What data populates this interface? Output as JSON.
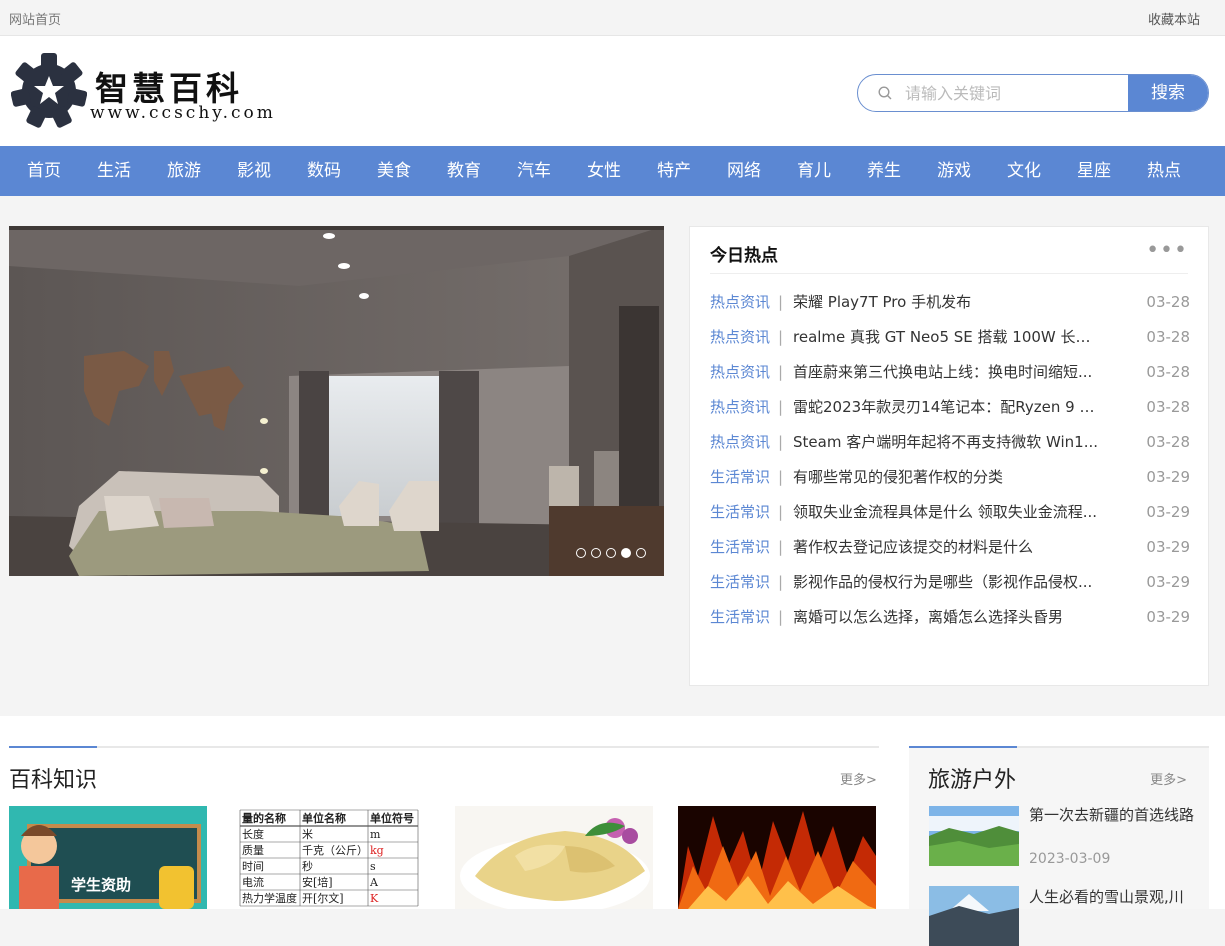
{
  "topbar": {
    "home": "网站首页",
    "favorite": "收藏本站"
  },
  "logo": {
    "title": "智慧百科",
    "domain": "www.ccschy.com"
  },
  "search": {
    "placeholder": "请输入关键词",
    "button": "搜索"
  },
  "nav": [
    "首页",
    "生活",
    "旅游",
    "影视",
    "数码",
    "美食",
    "教育",
    "汽车",
    "女性",
    "特产",
    "网络",
    "育儿",
    "养生",
    "游戏",
    "文化",
    "星座",
    "热点"
  ],
  "slider": {
    "active_index": 3,
    "count": 5
  },
  "hot": {
    "title": "今日热点",
    "items": [
      {
        "cat": "热点资讯",
        "text": "荣耀 Play7T Pro 手机发布",
        "date": "03-28"
      },
      {
        "cat": "热点资讯",
        "text": "realme 真我 GT Neo5 SE 搭载 100W 长寿...",
        "date": "03-28"
      },
      {
        "cat": "热点资讯",
        "text": "首座蔚来第三代换电站上线：换电时间缩短...",
        "date": "03-28"
      },
      {
        "cat": "热点资讯",
        "text": "雷蛇2023年款灵刃14笔记本：配Ryzen 9 7...",
        "date": "03-28"
      },
      {
        "cat": "热点资讯",
        "text": "Steam 客户端明年起将不再支持微软 Win1...",
        "date": "03-28"
      },
      {
        "cat": "生活常识",
        "text": "有哪些常见的侵犯著作权的分类",
        "date": "03-29"
      },
      {
        "cat": "生活常识",
        "text": "领取失业金流程具体是什么 领取失业金流程...",
        "date": "03-29"
      },
      {
        "cat": "生活常识",
        "text": "著作权去登记应该提交的材料是什么",
        "date": "03-29"
      },
      {
        "cat": "生活常识",
        "text": "影视作品的侵权行为是哪些（影视作品侵权...",
        "date": "03-29"
      },
      {
        "cat": "生活常识",
        "text": "离婚可以怎么选择，离婚怎么选择头昏男",
        "date": "03-29"
      }
    ]
  },
  "baike": {
    "title": "百科知识",
    "more": "更多>",
    "thumb1_text": "学生资助",
    "table": {
      "headers": [
        "量的名称",
        "单位名称",
        "单位符号"
      ],
      "rows": [
        [
          "长度",
          "米",
          "m"
        ],
        [
          "质量",
          "千克（公斤）",
          "kg"
        ],
        [
          "时间",
          "秒",
          "s"
        ],
        [
          "电流",
          "安[培]",
          "A"
        ],
        [
          "热力学温度",
          "开[尔文]",
          "K"
        ]
      ]
    }
  },
  "travel": {
    "title": "旅游户外",
    "more": "更多>",
    "items": [
      {
        "title": "第一次去新疆的首选线路",
        "date": "2023-03-09"
      },
      {
        "title": "人生必看的雪山景观,川",
        "date": ""
      }
    ]
  },
  "colors": {
    "accent": "#5b87d3"
  }
}
